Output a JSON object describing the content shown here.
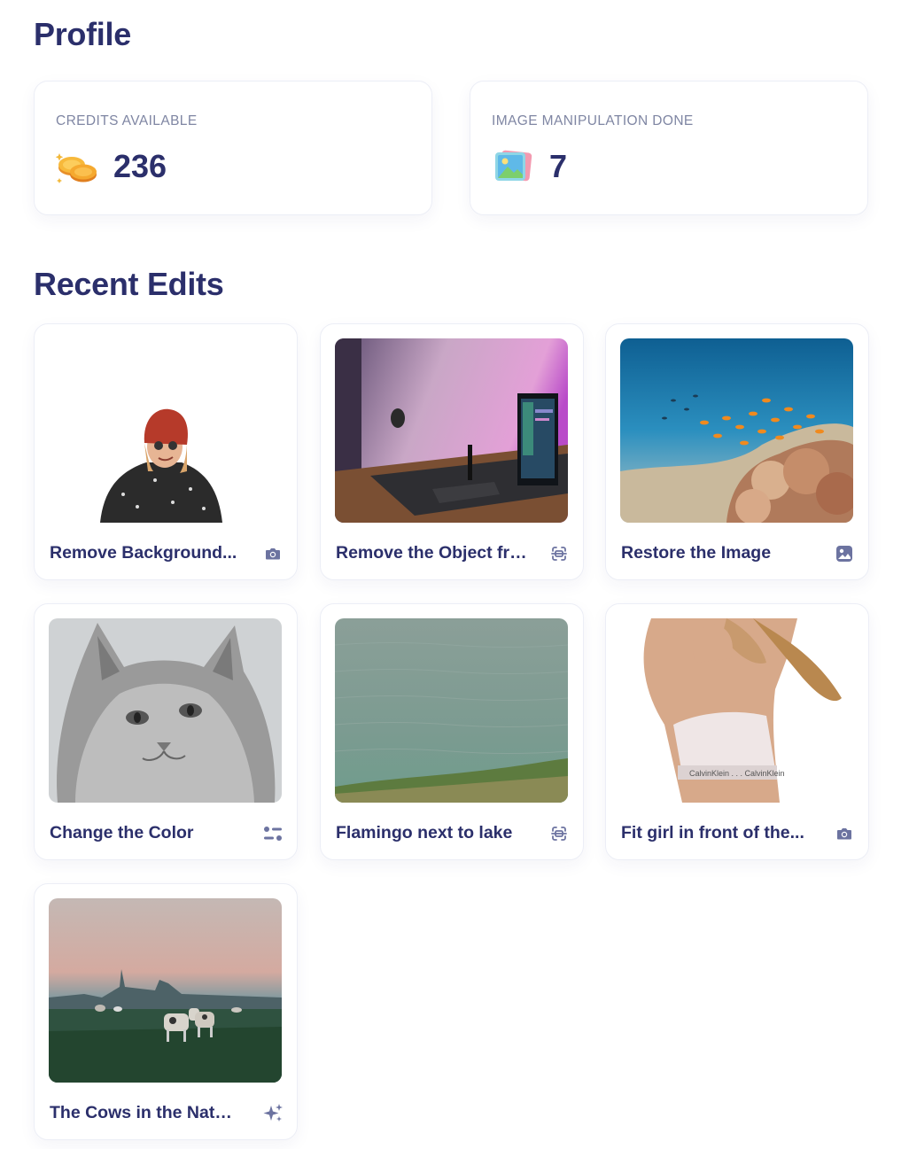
{
  "page": {
    "title": "Profile",
    "recent_title": "Recent Edits"
  },
  "stats": [
    {
      "label": "CREDITS AVAILABLE",
      "value": "236",
      "icon": "coins-icon"
    },
    {
      "label": "IMAGE MANIPULATION DONE",
      "value": "7",
      "icon": "image-gallery-icon"
    }
  ],
  "edits": [
    {
      "title": "Remove Background...",
      "icon": "camera-icon",
      "thumb": "woman-red-beanie-cutout"
    },
    {
      "title": "Remove the Object fro...",
      "icon": "scan-object-icon",
      "thumb": "desk-setup-purple-light"
    },
    {
      "title": "Restore the Image",
      "icon": "image-icon",
      "thumb": "coral-reef-fish"
    },
    {
      "title": "Change the Color",
      "icon": "sliders-icon",
      "thumb": "grayscale-cat"
    },
    {
      "title": "Flamingo next to lake",
      "icon": "scan-object-icon",
      "thumb": "lake-water-grass"
    },
    {
      "title": "Fit girl in front of the...",
      "icon": "camera-icon",
      "thumb": "woman-sports-bra-cutout"
    },
    {
      "title": "The Cows in the Nature",
      "icon": "sparkles-icon",
      "thumb": "cows-field-dusk"
    }
  ],
  "colors": {
    "heading": "#2b2f6b",
    "label": "#7f86a3",
    "icon": "#6c73a0",
    "border": "#eceef6"
  }
}
